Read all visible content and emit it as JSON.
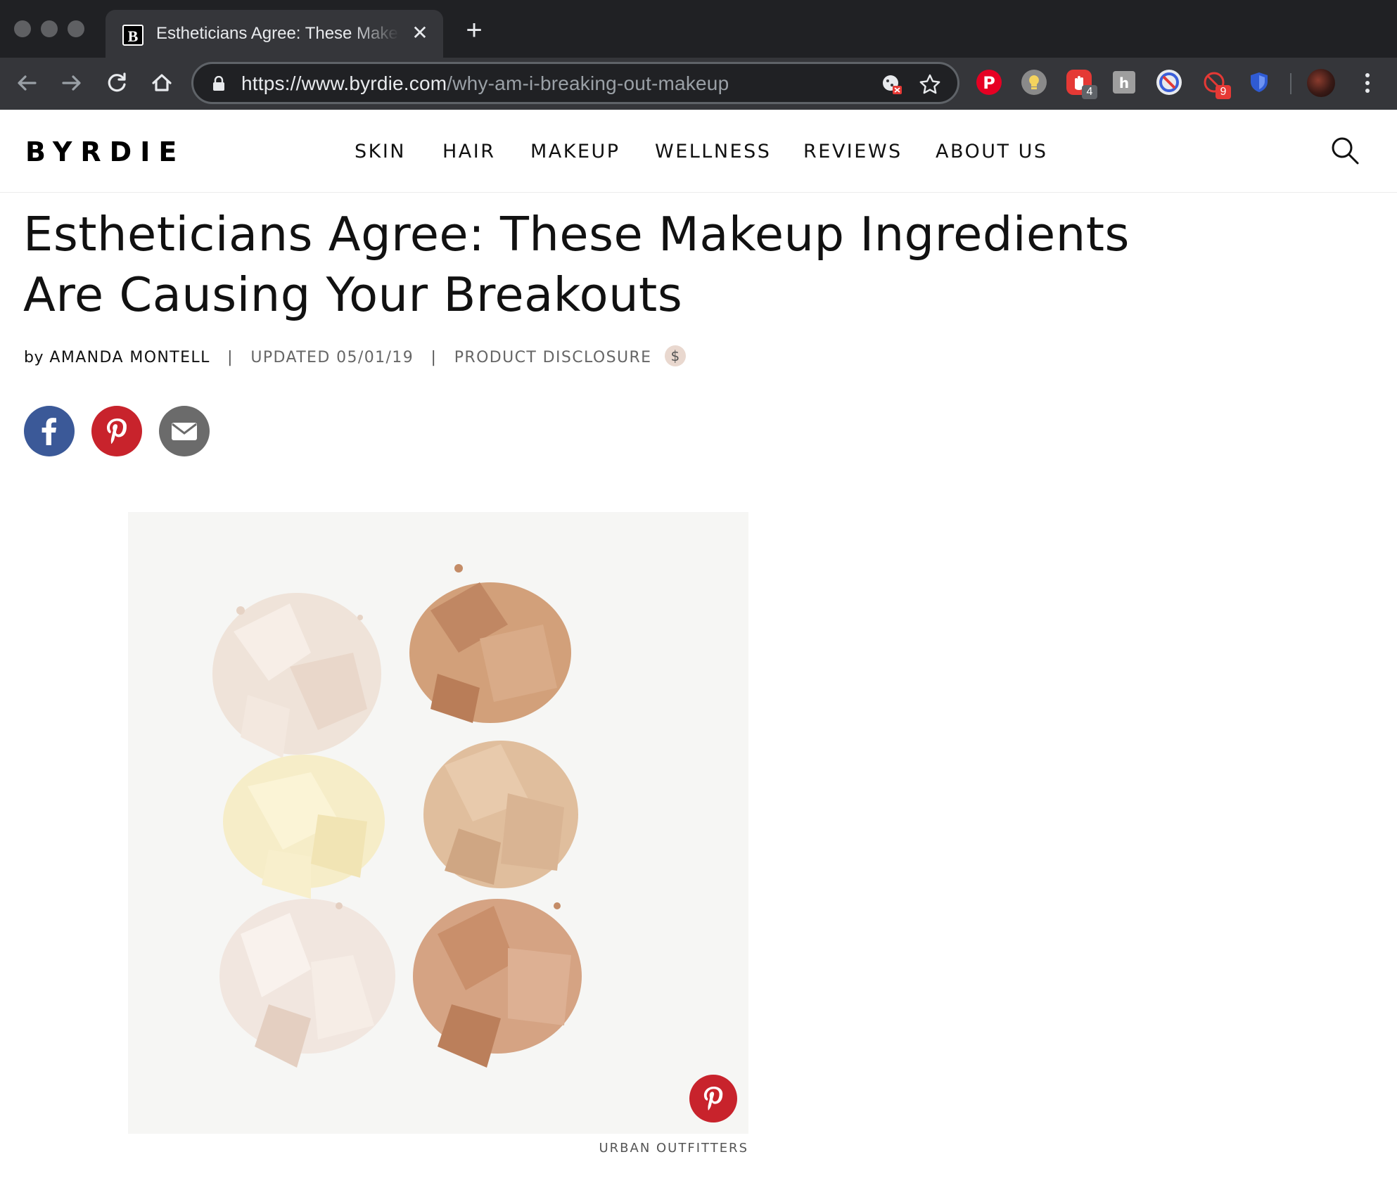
{
  "browser": {
    "tab_title": "Estheticians Agree: These Makeup Ingredients Are Causing Your Breakouts",
    "tab_favicon_letter": "B",
    "url_host": "https://www.byrdie.com",
    "url_path": "/why-am-i-breaking-out-makeup",
    "extensions": [
      {
        "name": "pinterest-extension-icon",
        "color": "#e60023"
      },
      {
        "name": "bulb-extension-icon",
        "color": "#8a8a8a"
      },
      {
        "name": "adblock-extension-icon",
        "color": "#e53935",
        "badge": "4"
      },
      {
        "name": "honey-extension-icon",
        "color": "#9e9e9e"
      },
      {
        "name": "blocker-extension-icon",
        "color": "#3b5fd9"
      },
      {
        "name": "tracker-extension-icon",
        "color": "#e53935",
        "badge": "9"
      },
      {
        "name": "shield-extension-icon",
        "color": "#2f5bd3"
      }
    ]
  },
  "site": {
    "logo": "BYRDIE",
    "nav": [
      "SKIN",
      "HAIR",
      "MAKEUP",
      "WELLNESS",
      "REVIEWS",
      "ABOUT US"
    ]
  },
  "article": {
    "headline": "Estheticians Agree: These Makeup Ingredients Are Causing Your Breakouts",
    "byline_prefix": "by",
    "author": "AMANDA MONTELL",
    "updated": "UPDATED 05/01/19",
    "disclosure": "PRODUCT DISCLOSURE",
    "disclosure_symbol": "$",
    "separator": "|",
    "image_caption": "URBAN OUTFITTERS"
  },
  "colors": {
    "facebook": "#3b5998",
    "pinterest": "#c8232c",
    "email": "#6b6b6b",
    "chrome_dark": "#202124",
    "chrome_toolbar": "#35363a"
  }
}
